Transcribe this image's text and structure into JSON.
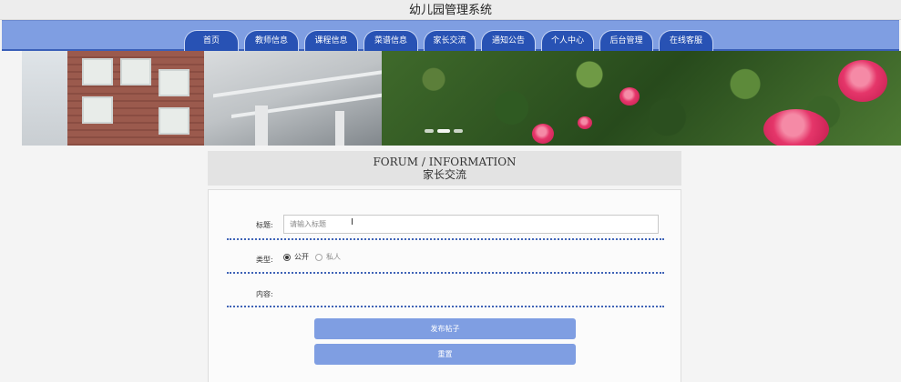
{
  "header": {
    "title": "幼儿园管理系统"
  },
  "nav": {
    "tabs": [
      {
        "label": "首页"
      },
      {
        "label": "教师信息"
      },
      {
        "label": "课程信息"
      },
      {
        "label": "菜谱信息"
      },
      {
        "label": "家长交流"
      },
      {
        "label": "通知公告"
      },
      {
        "label": "个人中心"
      },
      {
        "label": "后台管理"
      },
      {
        "label": "在线客服"
      }
    ]
  },
  "section": {
    "title_en": "FORUM / INFORMATION",
    "title_cn": "家长交流"
  },
  "form": {
    "title_label": "标题:",
    "title_placeholder": "请输入标题",
    "type_label": "类型:",
    "type_options": [
      {
        "label": "公开",
        "checked": true
      },
      {
        "label": "私人",
        "checked": false
      }
    ],
    "content_label": "内容:",
    "submit_label": "发布帖子",
    "reset_label": "重置"
  },
  "colors": {
    "nav_bg": "#7f9ee2",
    "tab_bg": "#2852b4",
    "divider": "#3f63b6",
    "button": "#7f9ee2"
  }
}
